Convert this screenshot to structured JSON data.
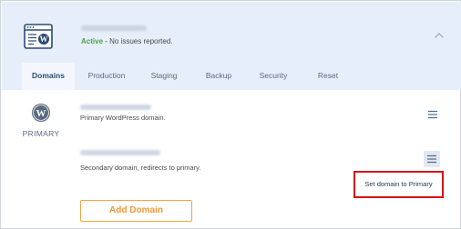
{
  "site": {
    "status_label": "Active",
    "status_text": " - No issues reported."
  },
  "tabs": [
    {
      "label": "Domains",
      "active": true
    },
    {
      "label": "Production",
      "active": false
    },
    {
      "label": "Staging",
      "active": false
    },
    {
      "label": "Backup",
      "active": false
    },
    {
      "label": "Security",
      "active": false
    },
    {
      "label": "Reset",
      "active": false
    }
  ],
  "primary": {
    "badge": "PRIMARY",
    "description": "Primary WordPress domain."
  },
  "secondary": {
    "description": "Secondary domain, redirects to primary."
  },
  "dropdown": {
    "item": "Set domain to Primary"
  },
  "actions": {
    "add_domain": "Add Domain"
  },
  "colors": {
    "header_bg": "#e6eefa",
    "active_status": "#4aa241",
    "accent_orange": "#f0a640",
    "highlight_red": "#d5101a"
  }
}
